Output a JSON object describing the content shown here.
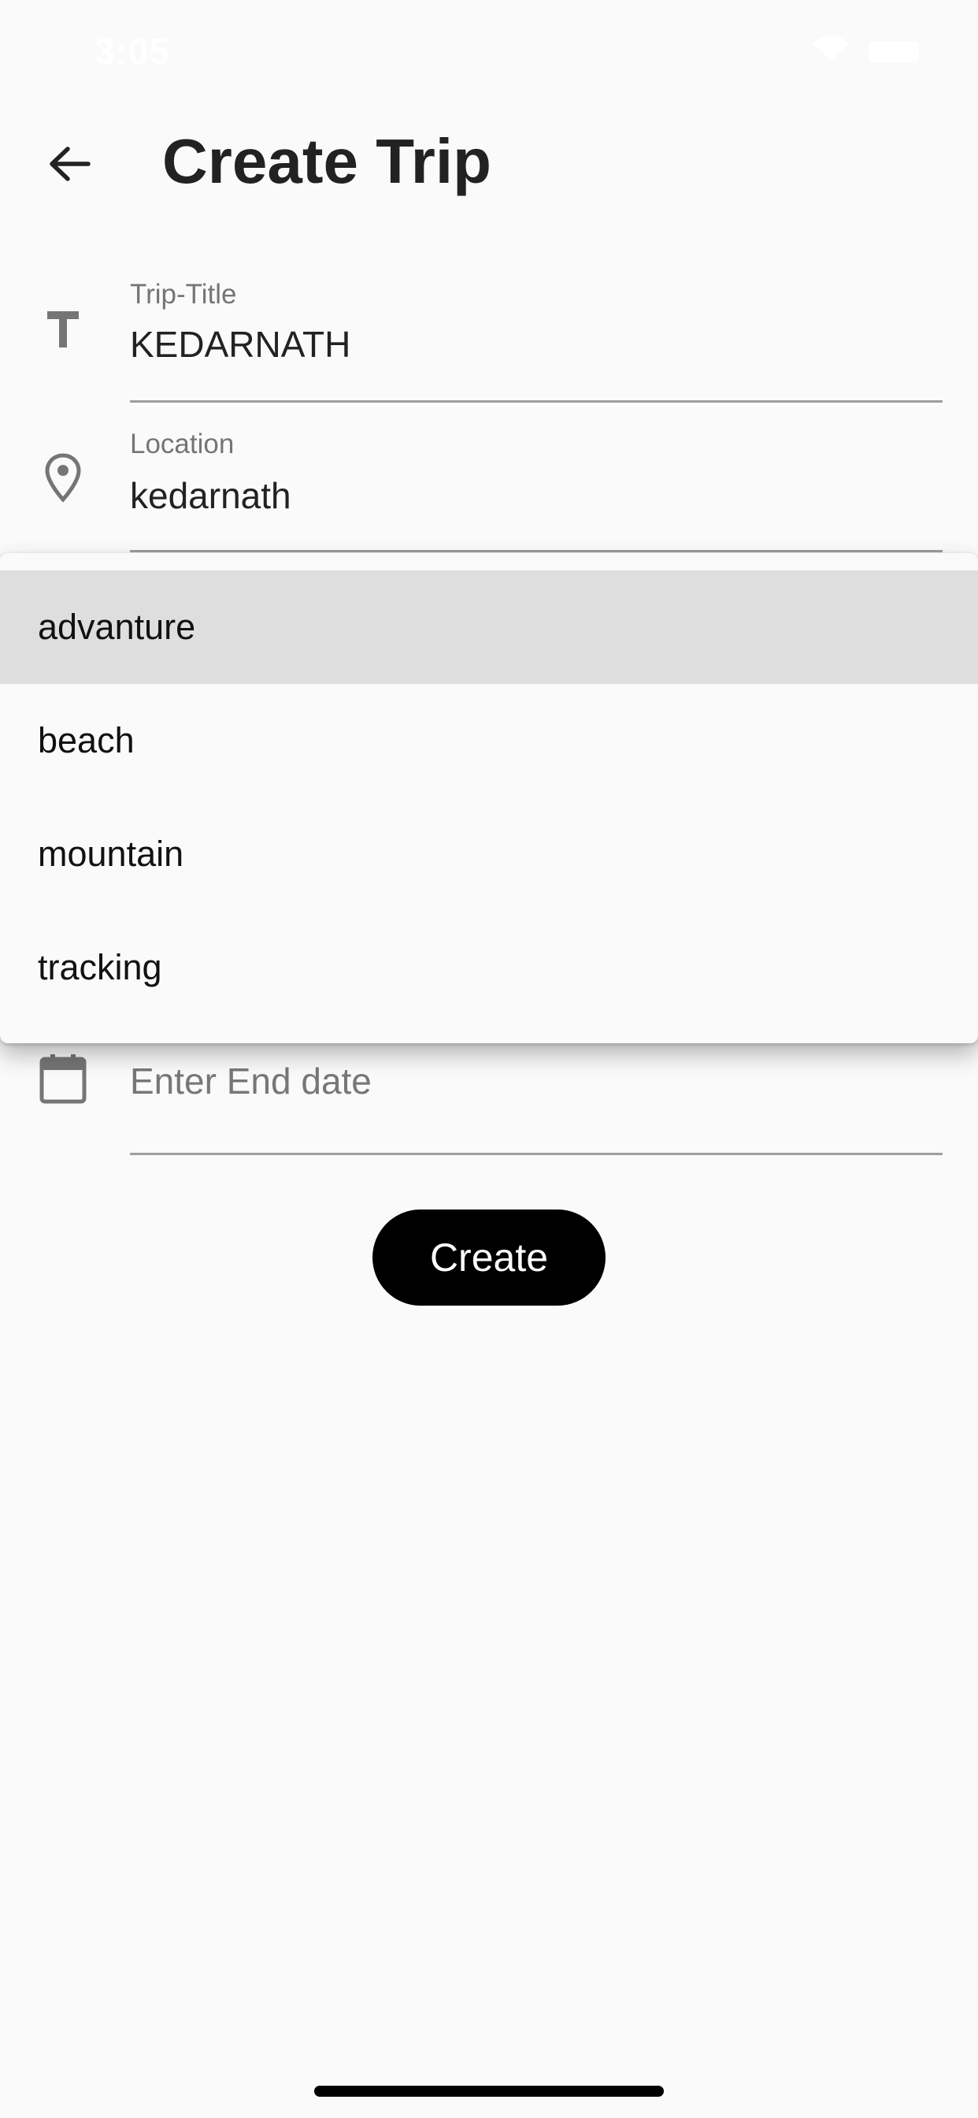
{
  "status_bar": {
    "time": "3:05"
  },
  "header": {
    "back_icon": "arrow-left-icon",
    "title": "Create Trip"
  },
  "form": {
    "trip_title": {
      "icon": "text-format-icon",
      "label": "Trip-Title",
      "value": "KEDARNATH"
    },
    "location": {
      "icon": "location-pin-icon",
      "label": "Location",
      "value": "kedarnath"
    },
    "end_date": {
      "icon": "calendar-icon",
      "placeholder": "Enter End date"
    },
    "create_label": "Create"
  },
  "dropdown": {
    "selected": "advanture",
    "options": [
      "advanture",
      "beach",
      "mountain",
      "tracking"
    ]
  },
  "colors": {
    "background": "#fafafa",
    "button": "#000000",
    "selected_option": "#dedede",
    "icon": "#757575"
  }
}
